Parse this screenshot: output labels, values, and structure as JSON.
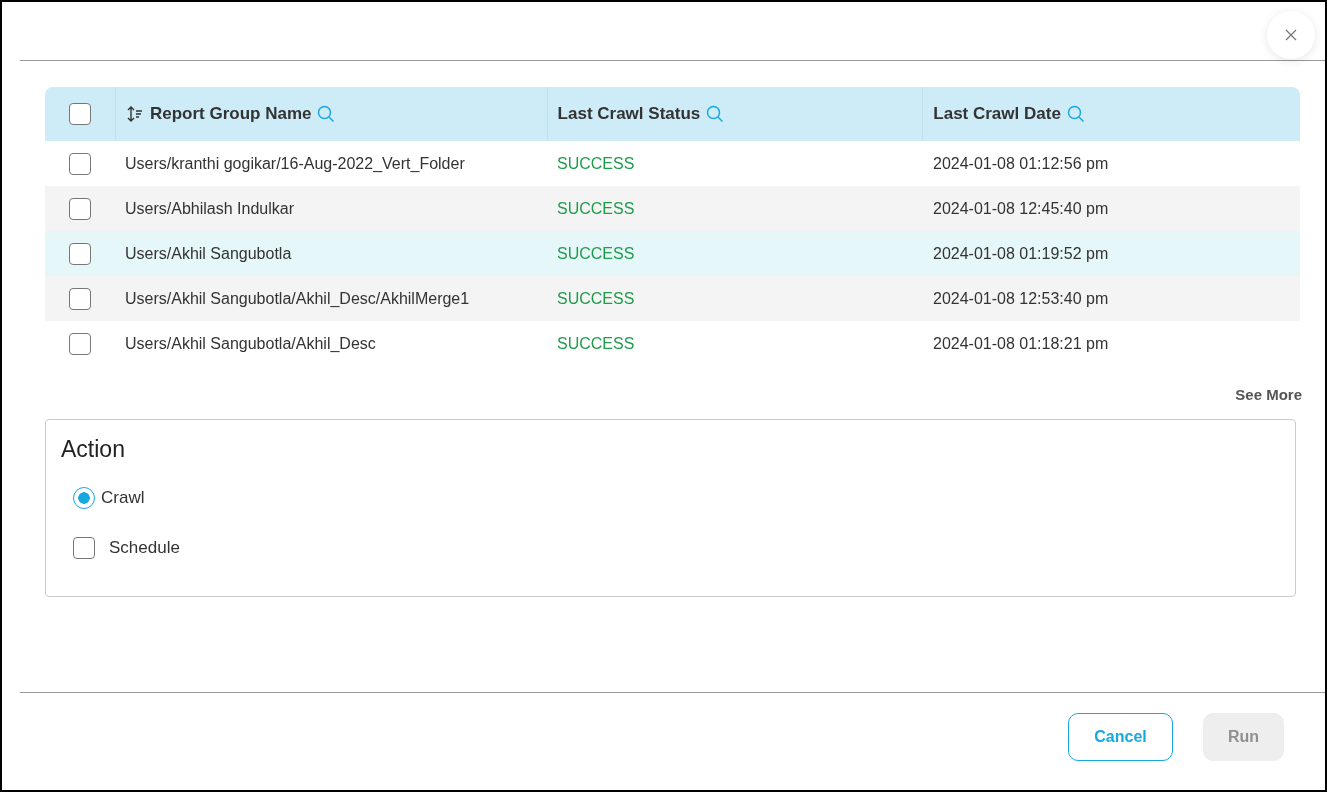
{
  "table": {
    "select_all_checked": false,
    "columns": [
      {
        "label": "Report Group Name",
        "sortable": true,
        "searchable": true
      },
      {
        "label": "Last Crawl Status",
        "sortable": false,
        "searchable": true
      },
      {
        "label": "Last Crawl Date",
        "sortable": false,
        "searchable": true
      }
    ],
    "rows": [
      {
        "checked": false,
        "highlighted": false,
        "name": "Users/kranthi gogikar/16-Aug-2022_Vert_Folder",
        "status": "SUCCESS",
        "date": "2024-01-08 01:12:56 pm"
      },
      {
        "checked": false,
        "highlighted": false,
        "name": "Users/Abhilash Indulkar",
        "status": "SUCCESS",
        "date": "2024-01-08 12:45:40 pm"
      },
      {
        "checked": false,
        "highlighted": true,
        "name": "Users/Akhil Sangubotla",
        "status": "SUCCESS",
        "date": "2024-01-08 01:19:52 pm"
      },
      {
        "checked": false,
        "highlighted": false,
        "name": "Users/Akhil Sangubotla/Akhil_Desc/AkhilMerge1",
        "status": "SUCCESS",
        "date": "2024-01-08 12:53:40 pm"
      },
      {
        "checked": false,
        "highlighted": false,
        "name": "Users/Akhil Sangubotla/Akhil_Desc",
        "status": "SUCCESS",
        "date": "2024-01-08 01:18:21 pm"
      }
    ],
    "see_more": "See More"
  },
  "action": {
    "title": "Action",
    "options": [
      {
        "kind": "radio",
        "label": "Crawl",
        "selected": true
      },
      {
        "kind": "checkbox",
        "label": "Schedule",
        "checked": false
      }
    ]
  },
  "buttons": [
    {
      "label": "Cancel",
      "disabled": false
    },
    {
      "label": "Run",
      "disabled": true
    }
  ]
}
